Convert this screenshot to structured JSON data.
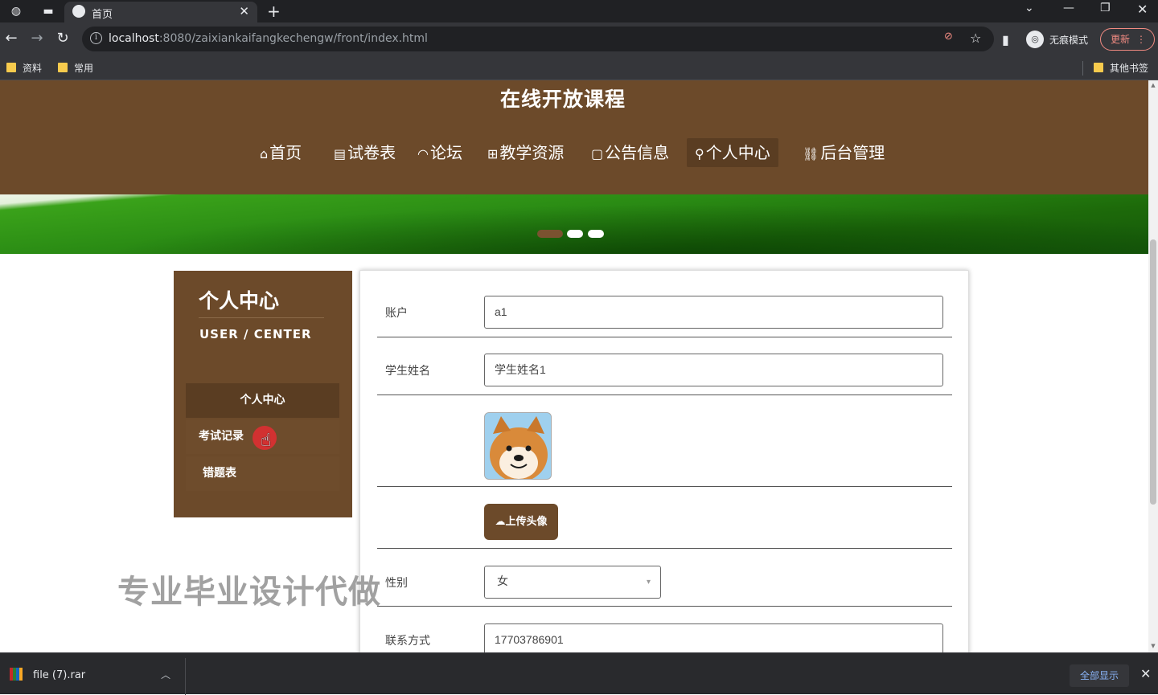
{
  "browser": {
    "tab_title": "首页",
    "url_host": "localhost",
    "url_rest": ":8080/zaixiankaifangkechengw/front/index.html",
    "incognito_label": "无痕模式",
    "update_label": "更新",
    "bookmarks": [
      "资料",
      "常用"
    ],
    "other_bookmarks": "其他书签"
  },
  "site": {
    "title": "在线开放课程",
    "nav": [
      {
        "icon": "⌂",
        "label": "首页"
      },
      {
        "icon": "▤",
        "label": "试卷表"
      },
      {
        "icon": "◠",
        "label": "论坛"
      },
      {
        "icon": "⊞",
        "label": "教学资源"
      },
      {
        "icon": "▢",
        "label": "公告信息"
      },
      {
        "icon": "⚲",
        "label": "个人中心"
      },
      {
        "icon": "⛓",
        "label": "后台管理"
      }
    ]
  },
  "sidebar": {
    "title": "个人中心",
    "subtitle": "USER / CENTER",
    "items": [
      {
        "label": "个人中心"
      },
      {
        "label": "考试记录"
      },
      {
        "label": "错题表"
      }
    ]
  },
  "form": {
    "account_label": "账户",
    "account_value": "a1",
    "name_label": "学生姓名",
    "name_value": "学生姓名1",
    "upload_label": "上传头像",
    "gender_label": "性别",
    "gender_value": "女",
    "phone_label": "联系方式",
    "phone_value": "17703786901"
  },
  "watermark": "专业毕业设计代做",
  "downloads": {
    "file_name": "file (7).rar",
    "show_all": "全部显示"
  },
  "colors": {
    "brand_brown": "#6c4a2a",
    "brand_brown_dark": "#5a3d22"
  }
}
